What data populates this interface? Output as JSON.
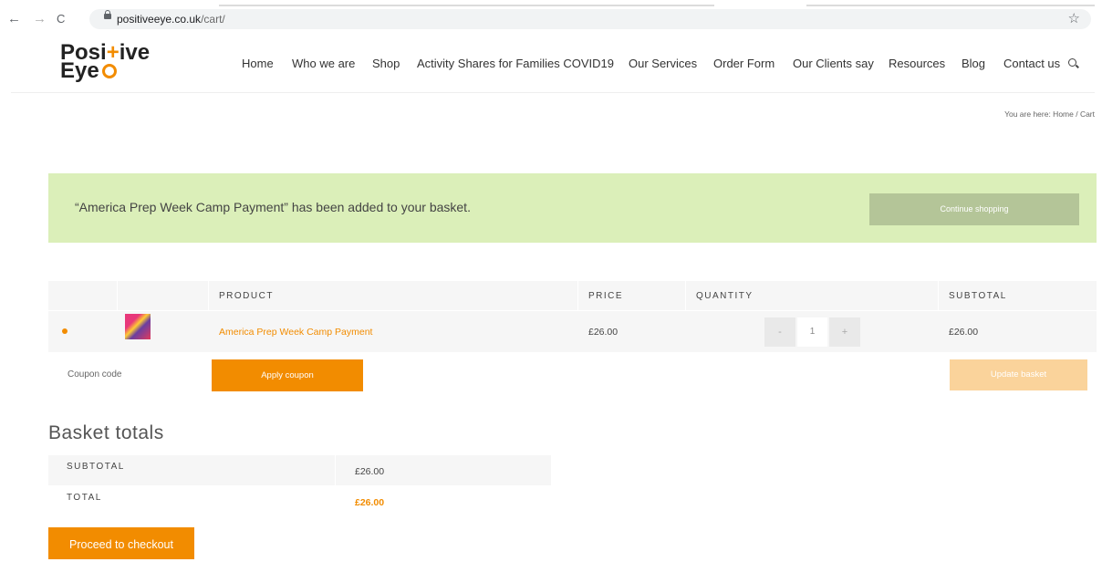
{
  "browser": {
    "back_icon": "←",
    "forward_icon": "→",
    "reload_icon": "C",
    "url_host": "positiveeye.co.uk",
    "url_path": "/cart/",
    "star_icon": "☆"
  },
  "site": {
    "logo_line1_a": "Posi",
    "logo_line1_plus": "+",
    "logo_line1_b": "ive",
    "logo_line2": "Eye",
    "nav": [
      "Home",
      "Who we are",
      "Shop",
      "Activity Shares for Families COVID19",
      "Our Services",
      "Order Form",
      "Our Clients say",
      "Resources",
      "Blog",
      "Contact us"
    ]
  },
  "breadcrumb": "You are here:  Home  /  Cart",
  "notice": {
    "message": "“America Prep Week Camp Payment” has been added to your basket.",
    "button": "Continue shopping"
  },
  "cart": {
    "headers": {
      "product": "PRODUCT",
      "price": "PRICE",
      "quantity": "QUANTITY",
      "subtotal": "SUBTOTAL"
    },
    "item": {
      "name": "America Prep Week Camp Payment",
      "price": "£26.00",
      "qty_minus": "-",
      "quantity": "1",
      "qty_plus": "+",
      "subtotal": "£26.00"
    },
    "coupon_placeholder": "Coupon code",
    "apply_coupon": "Apply coupon",
    "update_basket": "Update basket"
  },
  "totals": {
    "title": "Basket totals",
    "subtotal_label": "SUBTOTAL",
    "subtotal_value": "£26.00",
    "total_label": "TOTAL",
    "total_value": "£26.00",
    "checkout": "Proceed to checkout"
  },
  "colors": {
    "accent": "#f28c00",
    "notice_bg": "#dbefb9"
  }
}
